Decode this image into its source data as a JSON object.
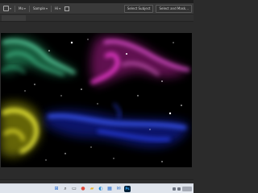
{
  "options_bar": {
    "controls": [
      {
        "name": "tool-preset-picker",
        "label": ""
      },
      {
        "name": "mode-select",
        "label": "Mo"
      },
      {
        "name": "sample-select",
        "label": "Sample"
      },
      {
        "name": "size-select",
        "label": "Hi"
      }
    ],
    "buttons": {
      "select_subject": "Select Subject",
      "select_and_mask": "Select and Mask..."
    }
  },
  "canvas": {
    "description_colors": {
      "green": "#40e0a0",
      "magenta": "#ff30e0",
      "yellow": "#f0f020",
      "blue": "#2040ff",
      "background": "#000000"
    }
  },
  "taskbar": {
    "icons": [
      {
        "name": "start-icon",
        "glyph": "⊞",
        "color": "#1e66d0"
      },
      {
        "name": "search-icon",
        "glyph": "⌕",
        "color": "#333333"
      },
      {
        "name": "task-view-icon",
        "glyph": "▭",
        "color": "#444444"
      },
      {
        "name": "chrome-icon",
        "glyph": "●",
        "color": "#e04a3a"
      },
      {
        "name": "file-explorer-icon",
        "glyph": "▰",
        "color": "#e8b730"
      },
      {
        "name": "edge-icon",
        "glyph": "◐",
        "color": "#1f8ad6"
      },
      {
        "name": "store-icon",
        "glyph": "▦",
        "color": "#2a6fd0"
      },
      {
        "name": "mail-icon",
        "glyph": "✉",
        "color": "#2f72c8"
      },
      {
        "name": "photoshop-icon",
        "glyph": "Ps",
        "color": "#31a8ff"
      }
    ]
  }
}
